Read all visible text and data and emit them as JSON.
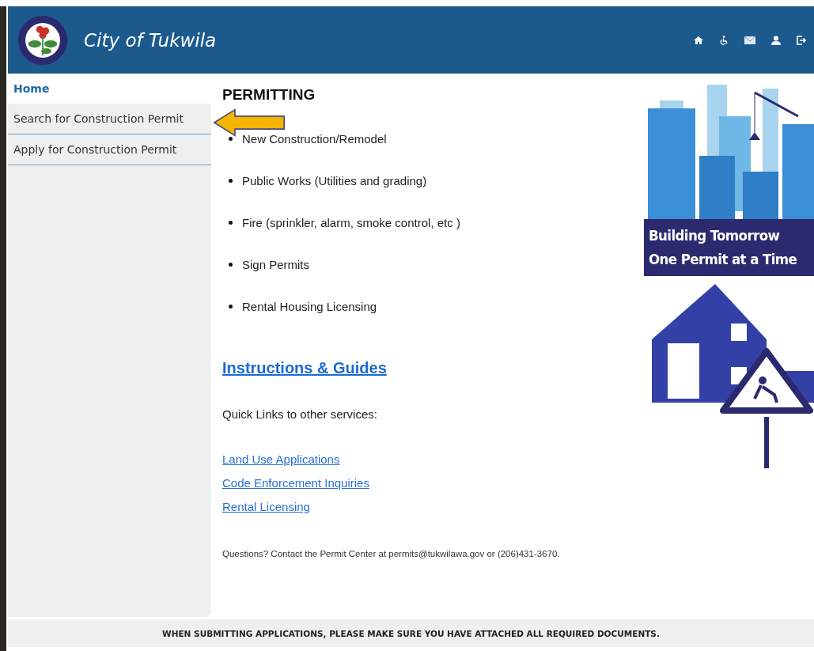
{
  "header": {
    "title": "City of Tukwila"
  },
  "sidebar": {
    "items": [
      {
        "label": "Home",
        "selected": true
      },
      {
        "label": "Search for Construction Permit",
        "selected": false
      },
      {
        "label": "Apply for Construction Permit",
        "selected": false
      }
    ]
  },
  "main": {
    "heading": "PERMITTING",
    "permit_types": [
      "New Construction/Remodel",
      "Public Works (Utilities and grading)",
      "Fire (sprinkler, alarm, smoke control, etc )",
      "Sign Permits",
      "Rental Housing Licensing"
    ],
    "guides_link": "Instructions & Guides",
    "quick_links_label": "Quick Links to other services:",
    "quick_links": [
      "Land Use Applications",
      "Code Enforcement Inquiries",
      "Rental Licensing"
    ],
    "contact": "Questions? Contact the Permit Center at permits@tukwilawa.gov or (206)431-3670."
  },
  "banner": {
    "line_1": "Building Tomorrow",
    "line_2": "One Permit at a Time"
  },
  "footer": {
    "notice": "WHEN SUBMITTING APPLICATIONS, PLEASE MAKE SURE YOU HAVE ATTACHED ALL REQUIRED DOCUMENTS."
  }
}
